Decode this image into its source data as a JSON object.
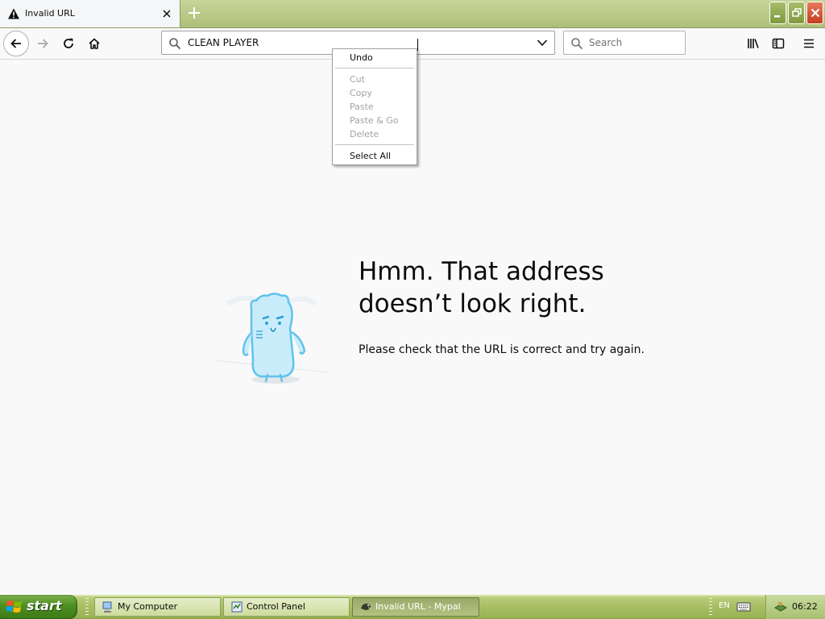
{
  "tab": {
    "title": "Invalid URL"
  },
  "urlbar": {
    "value": "CLEAN PLAYER"
  },
  "searchbar": {
    "placeholder": "Search"
  },
  "error_page": {
    "title": "Hmm. That address doesn’t look right.",
    "description": "Please check that the URL is correct and try again."
  },
  "context_menu": {
    "items": [
      {
        "label": "Undo",
        "enabled": true
      },
      {
        "label": "Cut",
        "enabled": false
      },
      {
        "label": "Copy",
        "enabled": false
      },
      {
        "label": "Paste",
        "enabled": false
      },
      {
        "label": "Paste & Go",
        "enabled": false
      },
      {
        "label": "Delete",
        "enabled": false
      },
      {
        "label": "Select All",
        "enabled": true
      }
    ]
  },
  "taskbar": {
    "start_label": "start",
    "tasks": [
      {
        "label": "My Computer",
        "active": false
      },
      {
        "label": "Control Panel",
        "active": false
      },
      {
        "label": "Invalid URL - Mypal",
        "active": true
      }
    ],
    "language": "EN",
    "clock": "06:22"
  },
  "colors": {
    "theme_olive": "#aebf78",
    "close_red": "#c3401f",
    "start_green": "#4d8f22",
    "illustration_blue": "#5fc3ec"
  }
}
